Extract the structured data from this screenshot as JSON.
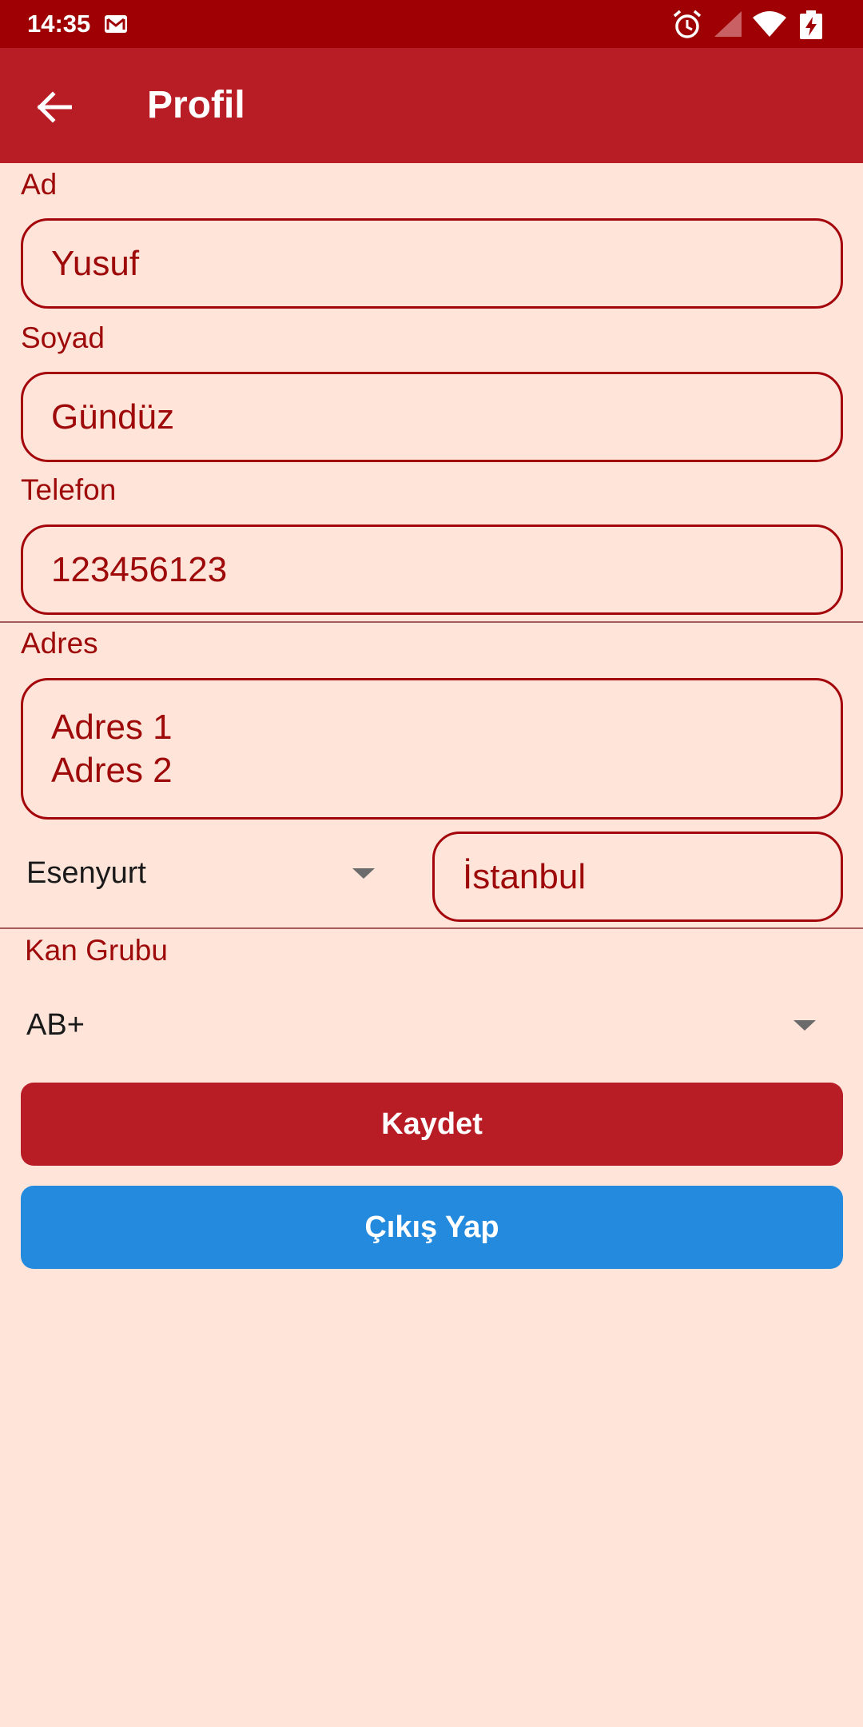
{
  "status_bar": {
    "time": "14:35",
    "icons": [
      "gmail-icon",
      "alarm-icon",
      "signal-icon",
      "wifi-icon",
      "battery-charging-icon"
    ]
  },
  "app_bar": {
    "title": "Profil",
    "back_icon": "arrow-left-icon"
  },
  "form": {
    "first_name": {
      "label": "Ad",
      "value": "Yusuf"
    },
    "last_name": {
      "label": "Soyad",
      "value": "Gündüz"
    },
    "phone": {
      "label": "Telefon",
      "value": "123456123"
    },
    "address": {
      "label": "Adres",
      "line1": "Adres 1",
      "line2": "Adres 2"
    },
    "district": {
      "selected": "Esenyurt"
    },
    "city": {
      "value": "İstanbul"
    },
    "blood_type": {
      "label": "Kan Grubu",
      "selected": "AB+"
    }
  },
  "buttons": {
    "save": "Kaydet",
    "logout": "Çıkış Yap"
  },
  "colors": {
    "status_bar": "#9E0004",
    "app_bar": "#B81D26",
    "background": "#FFE4DA",
    "field_border": "#A3050B",
    "field_text": "#9E0A0A",
    "save_button": "#B81D26",
    "logout_button": "#238ADE"
  }
}
